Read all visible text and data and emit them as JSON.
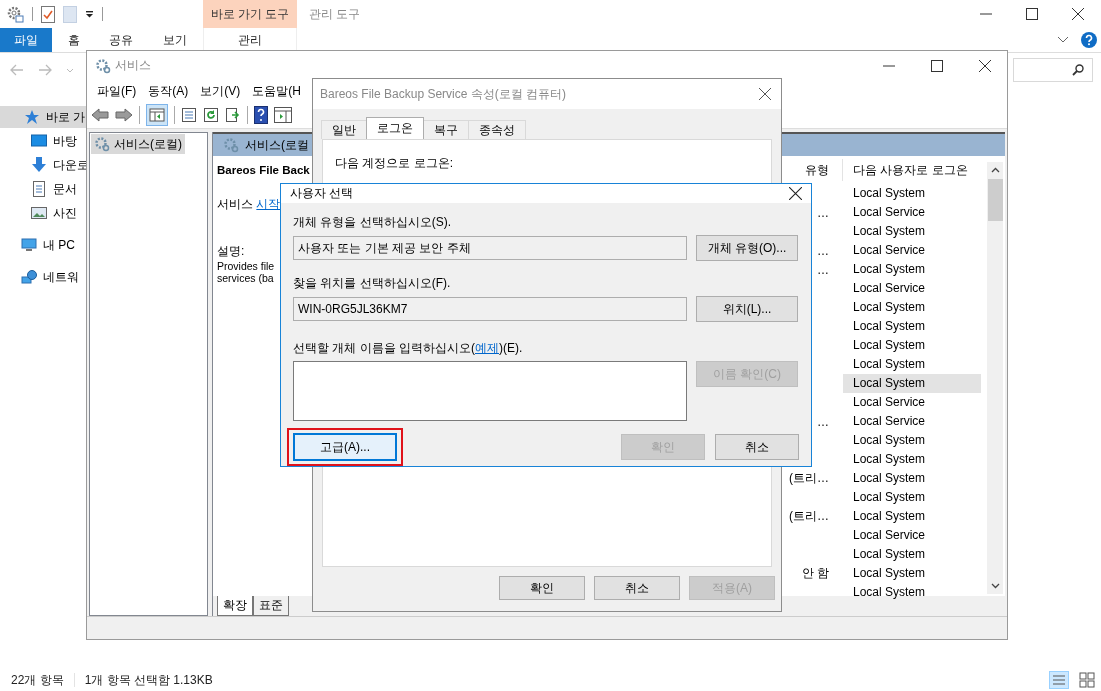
{
  "explorer": {
    "context_tab": "바로 가기 도구",
    "context_tab_2": "관리 도구",
    "ribbon_tabs": [
      {
        "label": "파일",
        "selected": true
      },
      {
        "label": "홈",
        "selected": false
      },
      {
        "label": "공유",
        "selected": false
      },
      {
        "label": "보기",
        "selected": false
      },
      {
        "label": "관리",
        "selected": false
      }
    ],
    "nav": [
      {
        "label": "바로 가",
        "kind": "star",
        "selected": true,
        "children": [
          {
            "label": "바탕",
            "kind": "desktop",
            "selected": false
          },
          {
            "label": "다운로",
            "kind": "download",
            "selected": false
          },
          {
            "label": "문서",
            "kind": "document",
            "selected": false
          },
          {
            "label": "사진",
            "kind": "picture",
            "selected": false
          }
        ]
      },
      {
        "label": "내 PC",
        "kind": "pc",
        "selected": false
      },
      {
        "label": "네트워",
        "kind": "network",
        "selected": false
      }
    ],
    "status": [
      "22개 항목",
      "1개 항목 선택함 1.13KB"
    ]
  },
  "services_window": {
    "title": "서비스",
    "menu": [
      "파일(F)",
      "동작(A)",
      "보기(V)",
      "도움말(H"
    ],
    "tree": [
      {
        "label": "서비스(로컬)",
        "selected": true
      }
    ],
    "pane_header": "서비스(로컬",
    "service_name": "Bareos File Back",
    "action_prefix": "서비스",
    "action_link": "시작",
    "description_label": "설명:",
    "description_lines": [
      "Provides file",
      "services (ba"
    ],
    "columns": [
      "유형",
      "다음 사용자로 로그온"
    ],
    "rows": [
      {
        "logon": "Local System",
        "selected": false
      },
      {
        "column_1": "…",
        "logon": "Local Service",
        "selected": false
      },
      {
        "logon": "Local System",
        "selected": false
      },
      {
        "column_1": "…",
        "logon": "Local Service",
        "selected": false
      },
      {
        "column_1": "…",
        "logon": "Local System",
        "selected": false
      },
      {
        "logon": "Local Service",
        "selected": false
      },
      {
        "logon": "Local System",
        "selected": false
      },
      {
        "logon": "Local System",
        "selected": false
      },
      {
        "logon": "Local System",
        "selected": false
      },
      {
        "logon": "Local System",
        "selected": false
      },
      {
        "logon": "Local System",
        "selected": true
      },
      {
        "logon": "Local Service",
        "selected": false
      },
      {
        "column_1": "…",
        "logon": "Local Service",
        "selected": false
      },
      {
        "logon": "Local System",
        "selected": false
      },
      {
        "logon": "Local System",
        "selected": false
      },
      {
        "column_1": "(트리…",
        "logon": "Local System",
        "selected": false
      },
      {
        "logon": "Local System",
        "selected": false
      },
      {
        "column_1": "(트리…",
        "logon": "Local System",
        "selected": false
      },
      {
        "logon": "Local Service",
        "selected": false
      },
      {
        "logon": "Local System",
        "selected": false
      },
      {
        "column_1": "안 함",
        "logon": "Local System",
        "selected": false
      },
      {
        "logon": "Local System",
        "selected": false
      }
    ],
    "bottom_tabs": [
      {
        "label": "확장",
        "selected": true
      },
      {
        "label": "표준",
        "selected": false
      }
    ]
  },
  "properties_dialog": {
    "title": "Bareos File Backup Service 속성(로컬 컴퓨터)",
    "tabs": [
      {
        "label": "일반",
        "selected": false
      },
      {
        "label": "로그온",
        "selected": true
      },
      {
        "label": "복구",
        "selected": false
      },
      {
        "label": "종속성",
        "selected": false
      }
    ],
    "logon_label": "다음 계정으로 로그온:",
    "buttons": [
      {
        "label": "확인",
        "disabled": false
      },
      {
        "label": "취소",
        "disabled": false
      },
      {
        "label": "적용(A)",
        "disabled": true
      }
    ]
  },
  "select_user_dialog": {
    "title": "사용자 선택",
    "object_type_label": "개체 유형을 선택하십시오(S).",
    "object_type_value": "사용자 또는 기본 제공 보안 주체",
    "object_type_button": "개체 유형(O)...",
    "location_label": "찾을 위치를 선택하십시오(F).",
    "location_value": "WIN-0RG5JL36KM7",
    "location_button": "위치(L)...",
    "name_label_before": "선택할 개체 이름을 입력하십시오(",
    "name_label_link": "예제",
    "name_label_after": ")(E).",
    "check_names": {
      "label": "이름 확인(C)",
      "disabled": true
    },
    "buttons": [
      {
        "label": "고급(A)...",
        "disabled": false,
        "focused": true,
        "highlighted": true
      },
      {
        "label": "확인",
        "disabled": true,
        "focused": false,
        "highlighted": false
      },
      {
        "label": "취소",
        "disabled": false,
        "focused": false,
        "highlighted": false
      }
    ]
  }
}
